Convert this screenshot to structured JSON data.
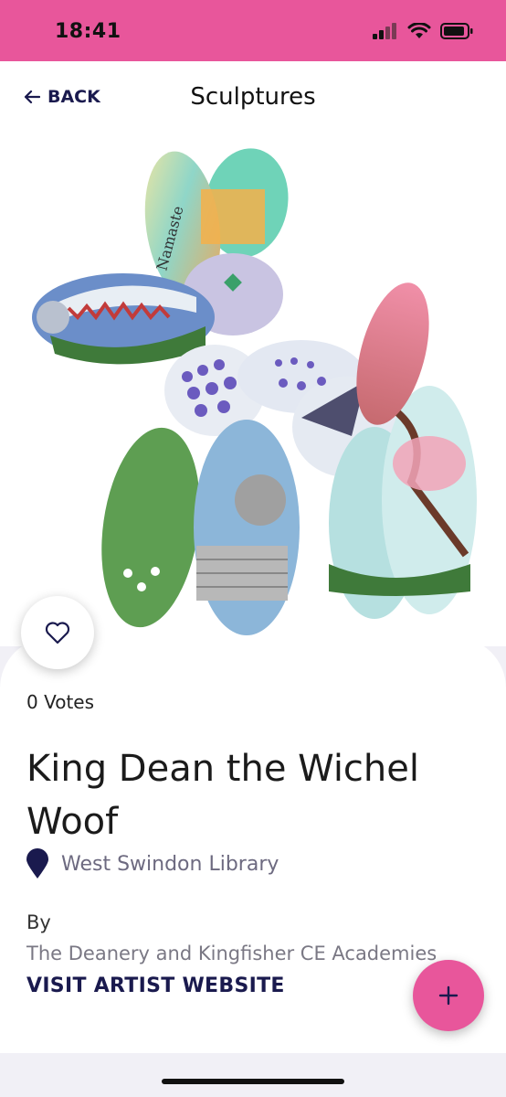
{
  "status_bar": {
    "time": "18:41",
    "color": "#e8569b"
  },
  "nav": {
    "back_label": "BACK",
    "title": "Sculptures"
  },
  "icons": {
    "back": "arrow-left-icon",
    "like": "heart-icon",
    "location": "map-pin-icon",
    "add": "plus-icon"
  },
  "sculpture": {
    "votes_label": "0 Votes",
    "name": "King Dean the Wichel Woof",
    "location": "West Swindon Library",
    "by_label": "By",
    "artist": "The Deanery and Kingfisher CE Academies",
    "artist_link_label": "VISIT ARTIST WEBSITE",
    "image_text": "Namaste"
  },
  "colors": {
    "accent": "#e8569b",
    "navy": "#1a1a4e",
    "muted": "#6d6a80"
  }
}
